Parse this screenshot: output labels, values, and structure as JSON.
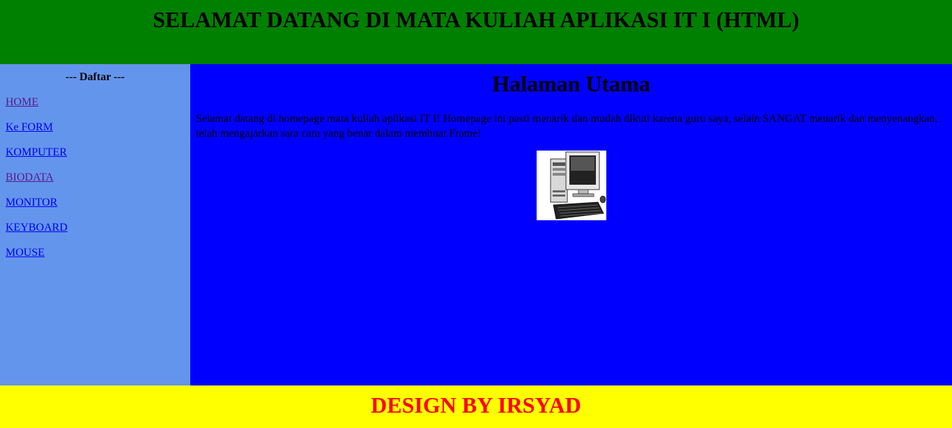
{
  "header": {
    "title": "SELAMAT DATANG DI MATA KULIAH APLIKASI IT I (HTML)",
    "background": "#008000"
  },
  "sidebar": {
    "title": "--- Daftar ---",
    "background": "#6495ED",
    "links": [
      {
        "label": "HOME",
        "visited": true
      },
      {
        "label": "Ke FORM",
        "visited": false
      },
      {
        "label": "KOMPUTER",
        "visited": false
      },
      {
        "label": "BIODATA",
        "visited": true
      },
      {
        "label": "MONITOR",
        "visited": false
      },
      {
        "label": "KEYBOARD",
        "visited": false
      },
      {
        "label": "MOUSE",
        "visited": false
      }
    ]
  },
  "main": {
    "heading": "Halaman Utama",
    "intro": "Selamat datang di homepage mata kuliah aplikasi IT I! Homepage ini pasti menarik dan mudah dikuti karena guru saya, selain SANGAT menarik dan menyenangkan, telah mengajarkan sara cara yang benar dalam membuat Frame!",
    "image_icon": "desktop-computer-icon",
    "background": "#0000FF"
  },
  "footer": {
    "text": "DESIGN BY IRSYAD",
    "text_color": "#FF0000",
    "background": "#FFFF00"
  }
}
